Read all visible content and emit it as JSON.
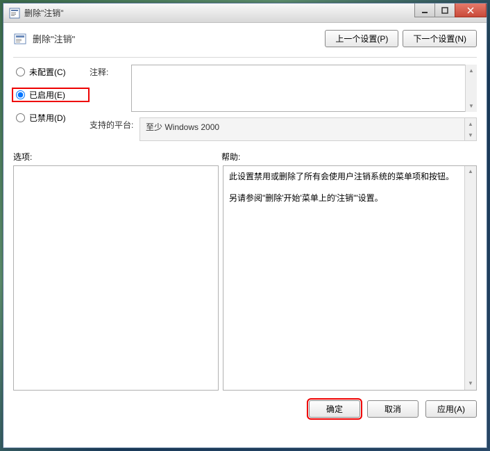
{
  "window": {
    "title": "删除\"注销\""
  },
  "header": {
    "title": "删除\"注销\"",
    "prev_button": "上一个设置(P)",
    "next_button": "下一个设置(N)"
  },
  "radios": {
    "not_configured": "未配置(C)",
    "enabled": "已启用(E)",
    "disabled": "已禁用(D)",
    "selected": "enabled"
  },
  "labels": {
    "comment": "注释:",
    "platform": "支持的平台:",
    "options": "选项:",
    "help": "帮助:"
  },
  "platform_text": "至少 Windows 2000",
  "help_text": {
    "line1": "此设置禁用或删除了所有会使用户注销系统的菜单项和按钮。",
    "line2": "另请参阅\"删除'开始'菜单上的'注销'\"设置。"
  },
  "footer": {
    "ok": "确定",
    "cancel": "取消",
    "apply": "应用(A)"
  }
}
